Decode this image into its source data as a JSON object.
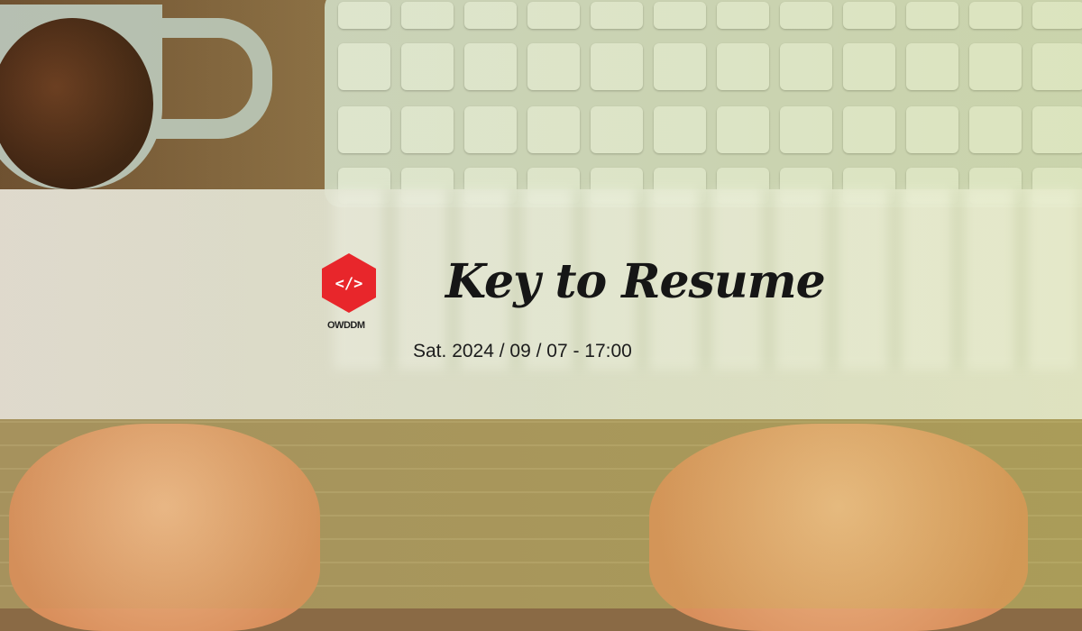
{
  "event": {
    "title": "Key to Resume",
    "datetime": "Sat. 2024 / 09 / 07 - 17:00"
  },
  "logo": {
    "text": "OWDDM",
    "icon": "code-brackets-icon",
    "color": "#e8262b"
  },
  "colors": {
    "band": "#e8e6dc",
    "text": "#1c1c1c"
  }
}
